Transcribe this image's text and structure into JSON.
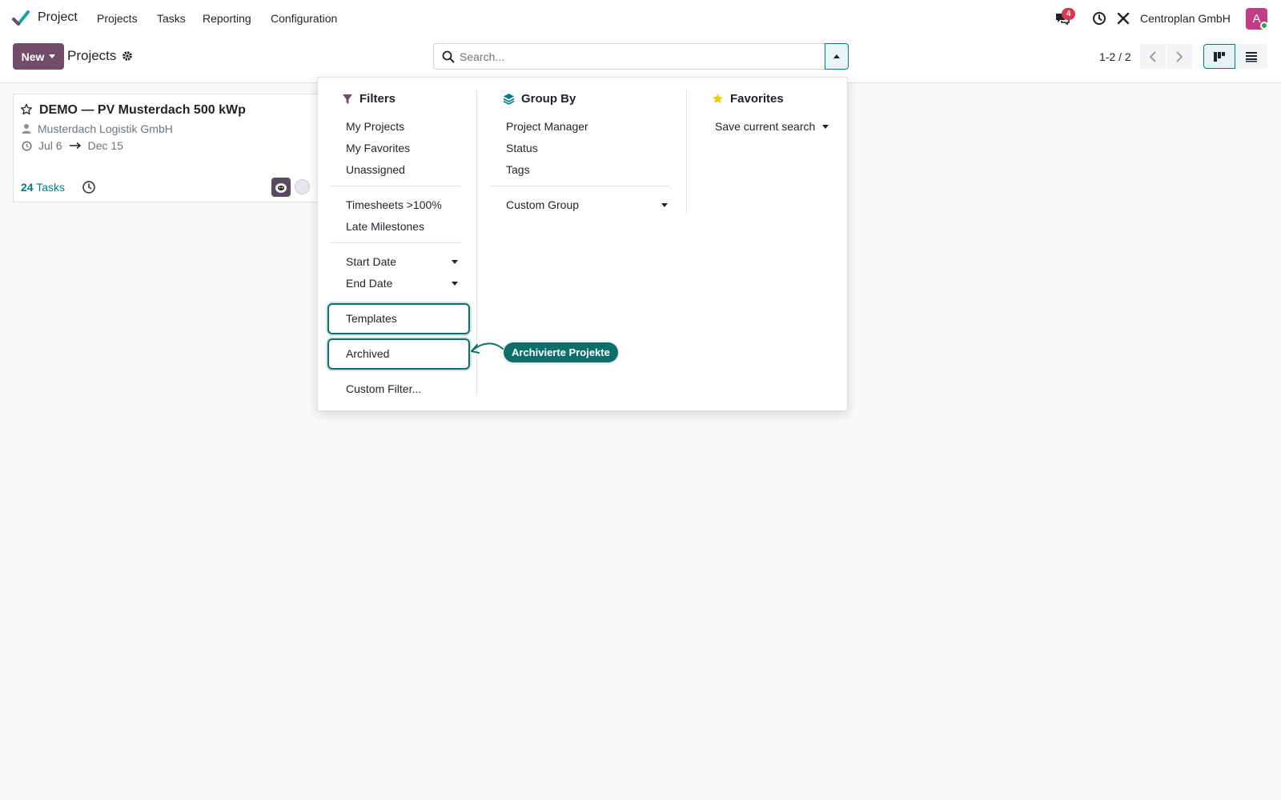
{
  "navbar": {
    "app_name": "Project",
    "menu": [
      "Projects",
      "Tasks",
      "Reporting",
      "Configuration"
    ],
    "message_count": "4",
    "company": "Centroplan GmbH",
    "avatar_letter": "A",
    "icons": [
      "chat-icon",
      "clock-icon",
      "tools-icon"
    ]
  },
  "control": {
    "new_label": "New",
    "title": "Projects",
    "search_placeholder": "Search...",
    "pager": "1-2 / 2"
  },
  "card": {
    "title": "DEMO — PV Musterdach 500 kWp",
    "customer": "Musterdach Logistik GmbH",
    "date_start": "Jul 6",
    "date_end": "Dec 15",
    "task_count": "24",
    "task_label": "Tasks"
  },
  "dropdown": {
    "filters": {
      "title": "Filters",
      "group1": [
        "My Projects",
        "My Favorites",
        "Unassigned"
      ],
      "group2": [
        "Timesheets >100%",
        "Late Milestones"
      ],
      "group3": [
        "Start Date",
        "End Date"
      ],
      "templates": "Templates",
      "archived": "Archived",
      "custom": "Custom Filter..."
    },
    "group_by": {
      "title": "Group By",
      "items": [
        "Project Manager",
        "Status",
        "Tags"
      ],
      "custom": "Custom Group"
    },
    "favorites": {
      "title": "Favorites",
      "save": "Save current search"
    }
  },
  "callout": "Archivierte Projekte",
  "colors": {
    "brand": "#714b67",
    "accent": "#017e84",
    "highlight": "#0e6f6a",
    "badge": "#d9384a",
    "favorite_star": "#f3cc00"
  }
}
